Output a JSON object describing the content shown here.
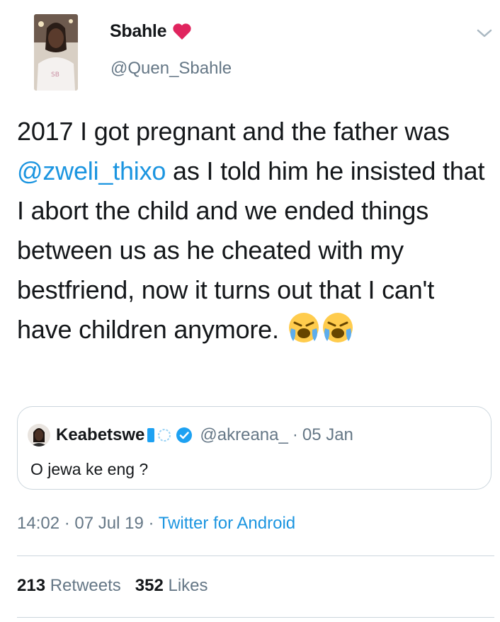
{
  "author": {
    "display_name": "Sbahle",
    "handle": "@Quen_Sbahle",
    "heart_color": "#e0245e"
  },
  "tweet": {
    "text_before": "2017 I got pregnant and the father was ",
    "mention": "@zweli_thixo",
    "text_after": " as I told him he insisted that I abort the child and we ended things between us as he cheated with my bestfriend, now it turns out that I can't have children anymore.",
    "emojis": [
      "loudly-crying-face-emoji",
      "loudly-crying-face-emoji"
    ]
  },
  "quoted_tweet": {
    "display_name": "Keabetswe",
    "handle": "@akreana_",
    "separator": "·",
    "date": "05 Jan",
    "text": "O jewa ke eng ?",
    "verified": true
  },
  "meta": {
    "time": "14:02",
    "separator": "·",
    "date": "07 Jul 19",
    "source": "Twitter for Android"
  },
  "stats": {
    "retweets_count": "213",
    "retweets_label": "Retweets",
    "likes_count": "352",
    "likes_label": "Likes"
  },
  "colors": {
    "link": "#1b95e0",
    "secondary_text": "#657786",
    "border": "#ccd6dd",
    "verified": "#1da1f2"
  }
}
